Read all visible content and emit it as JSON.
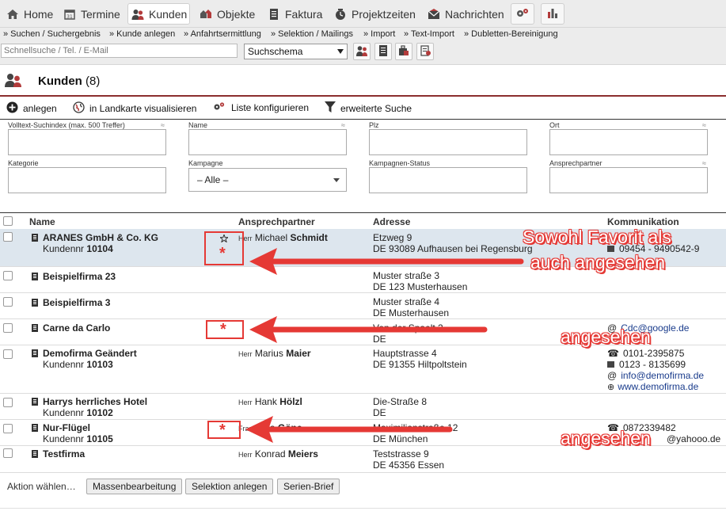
{
  "nav": {
    "items": [
      {
        "label": "Home",
        "icon": "home-icon"
      },
      {
        "label": "Termine",
        "icon": "calendar-icon"
      },
      {
        "label": "Kunden",
        "icon": "people-icon"
      },
      {
        "label": "Objekte",
        "icon": "objects-icon"
      },
      {
        "label": "Faktura",
        "icon": "invoice-icon"
      },
      {
        "label": "Projektzeiten",
        "icon": "clock-icon"
      },
      {
        "label": "Nachrichten",
        "icon": "envelope-icon"
      }
    ],
    "active": "Kunden"
  },
  "subnav": {
    "items": [
      "» Suchen / Suchergebnis",
      "» Kunde anlegen",
      "» Anfahrtsermittlung",
      "» Selektion / Mailings",
      "» Import",
      "» Text-Import",
      "» Dubletten-Bereinigung"
    ]
  },
  "toolbar": {
    "quick_search_placeholder": "Schnellsuche / Tel. / E-Mail",
    "schema_selected": "Suchschema"
  },
  "page": {
    "title": "Kunden",
    "count": "(8)"
  },
  "actions": {
    "add": "anlegen",
    "map": "in Landkarte visualisieren",
    "configure": "Liste konfigurieren",
    "extended_search": "erweiterte Suche"
  },
  "filters": {
    "fulltext": "Volltext-Suchindex (max. 500 Treffer)",
    "name": "Name",
    "zip": "Plz",
    "city": "Ort",
    "category": "Kategorie",
    "campaign": "Kampagne",
    "campaign_value": "– Alle –",
    "campaign_status": "Kampagnen-Status",
    "contact": "Ansprechpartner",
    "approx": "≈"
  },
  "table": {
    "headers": {
      "name": "Name",
      "contact": "Ansprechpartner",
      "address": "Adresse",
      "communication": "Kommunikation"
    },
    "rows": [
      {
        "name": "ARANES GmbH & Co. KG",
        "custno_label": "Kundennr",
        "custno": "10104",
        "salut": "Herr",
        "first": "Michael",
        "last": "Schmidt",
        "street": "Etzweg 9",
        "city": "DE 93089 Aufhausen bei Regensburg",
        "comm1": "09454 - 9490542-9"
      },
      {
        "name": "Beispielfirma 23",
        "street": "Muster straße 3",
        "city": "DE 123 Musterhausen"
      },
      {
        "name": "Beispielfirma 3",
        "street": "Muster straße 4",
        "city": "DE Musterhausen"
      },
      {
        "name": "Carne da Carlo",
        "street": "Von der Spaelt 2",
        "city": "DE",
        "comm1": "Cdc@google.de"
      },
      {
        "name": "Demofirma Geändert",
        "custno_label": "Kundennr",
        "custno": "10103",
        "salut": "Herr",
        "first": "Marius",
        "last": "Maier",
        "street": "Hauptstrasse 4",
        "city": "DE 91355 Hiltpoltstein",
        "comm1": "0101-2395875",
        "comm2": "0123 - 8135699",
        "comm3": "info@demofirma.de",
        "comm4": "www.demofirma.de"
      },
      {
        "name": "Harrys herrliches Hotel",
        "custno_label": "Kundennr",
        "custno": "10102",
        "salut": "Herr",
        "first": "Hank",
        "last": "Hölzl",
        "street": "Die-Straße 8",
        "city": "DE"
      },
      {
        "name": "Nur-Flügel",
        "custno_label": "Kundennr",
        "custno": "10105",
        "salut": "Frau",
        "first": "Julia",
        "last": "Göne",
        "street": "Maximilianstraße 12",
        "city": "DE München",
        "comm1": "0872339482",
        "comm2": "@yahooo.de"
      },
      {
        "name": "Testfirma",
        "salut": "Herr",
        "first": "Konrad",
        "last": "Meiers",
        "street": "Teststrasse 9",
        "city": "DE 45356 Essen"
      }
    ]
  },
  "annotations": {
    "line1": "Sowohl Favorit als",
    "line2": "auch angesehen",
    "seen1": "angesehen",
    "seen2": "angesehen",
    "star": "*",
    "color": "#e53935"
  },
  "bottom": {
    "action_select": "Aktion wählen…",
    "mass_edit": "Massenbearbeitung",
    "selection": "Selektion anlegen",
    "serial_letter": "Serien-Brief"
  },
  "colors": {
    "accent_line": "#8b2e2e",
    "highlight_row": "#dde6ee",
    "nav_bg": "#ececec",
    "link": "#1a3c8c"
  }
}
